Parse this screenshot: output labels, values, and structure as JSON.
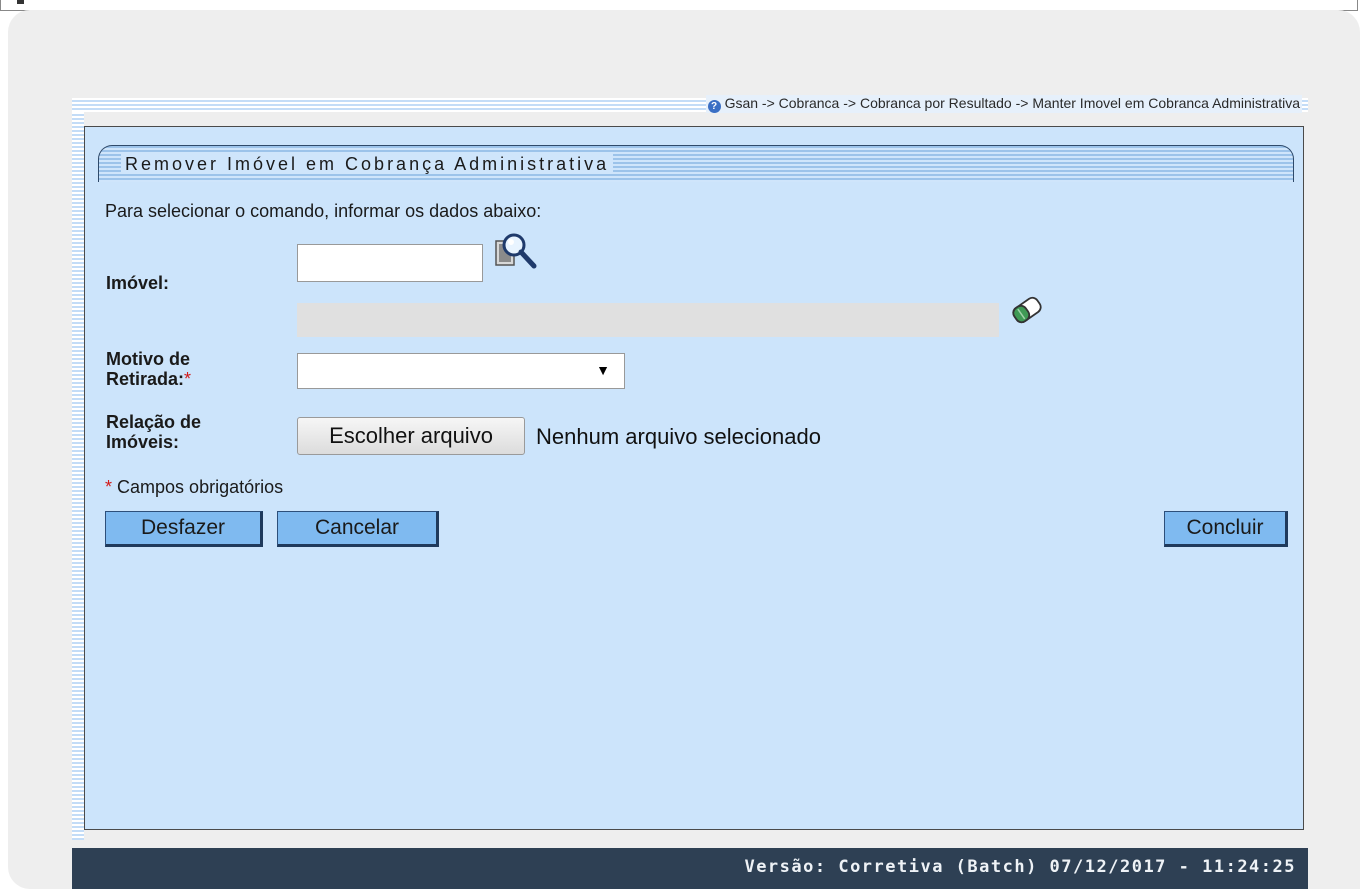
{
  "breadcrumb": "Gsan -> Cobranca -> Cobranca por Resultado -> Manter Imovel em Cobranca Administrativa",
  "panel": {
    "title": "Remover Imóvel em Cobrança Administrativa",
    "intro": "Para selecionar o comando, informar os dados abaixo:"
  },
  "form": {
    "imovel_label": "Imóvel:",
    "imovel_value": "",
    "imovel_description": "",
    "motivo_label_line1": "Motivo de",
    "motivo_label_line2": "Retirada:",
    "motivo_selected": "",
    "relacao_label_line1": "Relação de",
    "relacao_label_line2": "Imóveis:",
    "file_button": "Escolher arquivo",
    "file_status": "Nenhum arquivo selecionado",
    "required_marker": "*",
    "required_note": "Campos obrigatórios"
  },
  "buttons": {
    "desfazer": "Desfazer",
    "cancelar": "Cancelar",
    "concluir": "Concluir"
  },
  "footer": {
    "version": "Versão: Corretiva (Batch) 07/12/2017 - 11:24:25"
  },
  "icons": {
    "help": "help-icon",
    "search": "search-icon",
    "eraser": "eraser-icon"
  },
  "colors": {
    "panel_background": "#cce4fb",
    "button_background": "#7fbaf0",
    "footer_background": "#2e4054",
    "required_marker": "#d21919"
  }
}
